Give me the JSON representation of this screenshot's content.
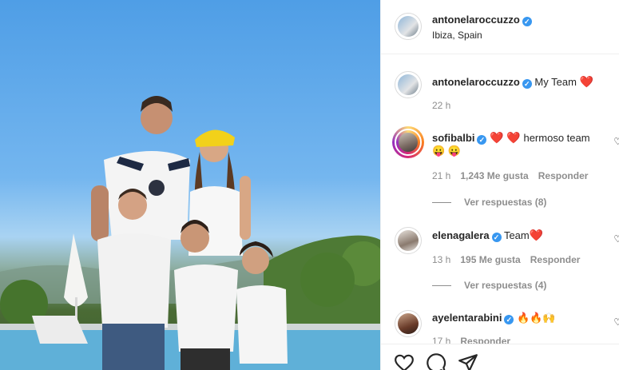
{
  "post": {
    "author": "antonelaroccuzzo",
    "location": "Ibiza, Spain"
  },
  "caption": {
    "author": "antonelaroccuzzo",
    "text": "My Team",
    "emoji": "❤️",
    "time": "22 h"
  },
  "comments": [
    {
      "author": "sofibalbi",
      "text": "hermoso team",
      "lead_emoji": "❤️ ❤️",
      "second_line_emoji": "😛 😛",
      "time": "21 h",
      "likes": "1,243 Me gusta",
      "reply": "Responder",
      "view_replies": "Ver respuestas (8)"
    },
    {
      "author": "elenagalera",
      "text": "Team",
      "emoji": "❤️",
      "time": "13 h",
      "likes": "195 Me gusta",
      "reply": "Responder",
      "view_replies": "Ver respuestas (4)"
    },
    {
      "author": "ayelentarabini",
      "text": "🔥🔥🙌",
      "time": "17 h",
      "reply": "Responder"
    }
  ],
  "icons": {
    "verified": "verified-badge-icon",
    "like": "heart-icon",
    "comment": "comment-icon",
    "share": "send-icon"
  },
  "colors": {
    "verified": "#3897f0",
    "heart": "#e0245e",
    "muted": "#8e8e8e"
  }
}
